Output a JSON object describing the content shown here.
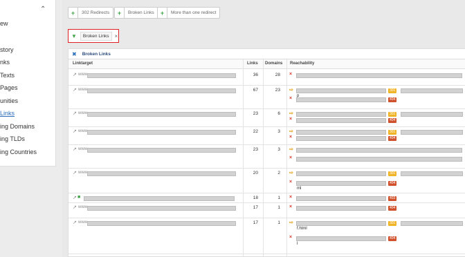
{
  "sidebar": {
    "items": [
      "ew",
      "story",
      "nks",
      "Texts",
      "Pages",
      "unities",
      "Links",
      "ing Domains",
      "ing TLDs",
      "ing Countries"
    ],
    "active_index": 6
  },
  "filters": {
    "buttons": [
      "302 Redirects",
      "Broken Links",
      "More than one redirect"
    ],
    "active": "Broken Links"
  },
  "panel": {
    "title": "Broken Links",
    "columns": [
      "Linktarget",
      "Links",
      "Domains",
      "Reachability"
    ]
  },
  "rows": [
    {
      "www": "www.",
      "links": "36",
      "domains": "28",
      "reach": [
        {
          "status": "x"
        }
      ]
    },
    {
      "www": "www.",
      "links": "67",
      "domains": "23",
      "reach": [
        {
          "status": "arrow",
          "badge": "301",
          "frag": "p"
        },
        {
          "status": "x",
          "badge": "404"
        }
      ]
    },
    {
      "www": "www.",
      "links": "23",
      "domains": "6",
      "reach": [
        {
          "status": "arrow",
          "badge": "301"
        },
        {
          "status": "x",
          "badge": "404"
        }
      ]
    },
    {
      "www": "www.",
      "links": "22",
      "domains": "3",
      "reach": [
        {
          "status": "arrow",
          "badge": "301"
        },
        {
          "status": "x",
          "badge": "404"
        }
      ]
    },
    {
      "www": "www.",
      "links": "23",
      "domains": "3",
      "reach": [
        {
          "status": "arrow"
        },
        {
          "status": "x"
        }
      ]
    },
    {
      "www": "www.",
      "links": "20",
      "domains": "2",
      "reach": [
        {
          "status": "arrow",
          "badge": "301"
        },
        {
          "status": "x",
          "badge": "404",
          "frag": "ml"
        }
      ]
    },
    {
      "www": "",
      "links": "18",
      "domains": "1",
      "reach": [
        {
          "status": "x",
          "badge": "403"
        }
      ]
    },
    {
      "www": "www.",
      "links": "17",
      "domains": "1",
      "reach": [
        {
          "status": "x",
          "badge": "404"
        }
      ]
    },
    {
      "www": "www.",
      "links": "17",
      "domains": "1",
      "reach": [
        {
          "status": "arrow",
          "badge": "301",
          "frag": "f.html"
        },
        {
          "status": "x",
          "badge": "404",
          "frag": "l"
        }
      ]
    }
  ],
  "colors": {
    "accent": "#2a6ebb",
    "green": "#3fa348",
    "red": "#d03a2a",
    "orange": "#f0b429"
  }
}
